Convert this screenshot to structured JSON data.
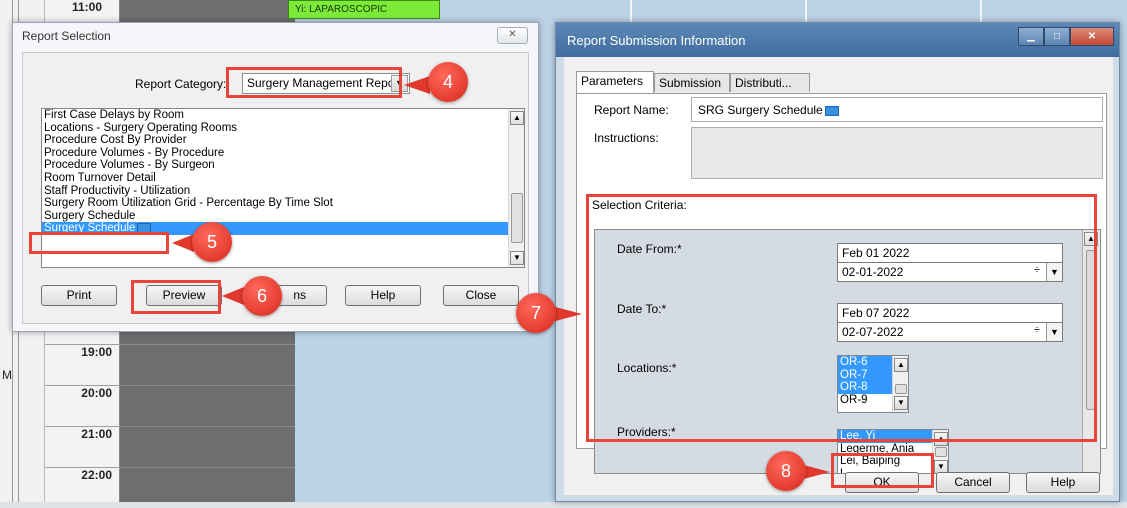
{
  "background": {
    "times": [
      "11:00",
      "19:00",
      "20:00",
      "21:00",
      "22:00"
    ],
    "case_label": "Yi: LAPAROSCOPIC",
    "edge_label": "M"
  },
  "report_selection": {
    "title": "Report Selection",
    "close_glyph": "✕",
    "category_label": "Report Category:",
    "category_value": "Surgery Management Repo",
    "reports": [
      "First Case Delays by Room",
      "Locations - Surgery Operating Rooms",
      "Procedure Cost By Provider",
      "Procedure Volumes - By Procedure",
      "Procedure Volumes - By Surgeon",
      "Room Turnover Detail",
      "Staff Productivity - Utilization",
      "Surgery Room Utilization Grid - Percentage By Time Slot",
      "Surgery Schedule",
      "Surgery Schedule"
    ],
    "selected_index": 9,
    "buttons": {
      "print": "Print",
      "preview": "Preview",
      "options": "ns",
      "help": "Help",
      "close": "Close"
    }
  },
  "submission": {
    "title": "Report Submission Information",
    "tabs": [
      "Parameters",
      "Submission",
      "Distributi..."
    ],
    "report_name_label": "Report Name:",
    "report_name_value": "SRG Surgery Schedule",
    "instructions_label": "Instructions:",
    "selection_criteria_label": "Selection Criteria:",
    "date_from_label": "Date From:*",
    "date_from_text": "Feb 01 2022",
    "date_from_value": "02-01-2022",
    "date_to_label": "Date To:*",
    "date_to_text": "Feb 07 2022",
    "date_to_value": "02-07-2022",
    "locations_label": "Locations:*",
    "locations": [
      "OR-6",
      "OR-7",
      "OR-8",
      "OR-9"
    ],
    "locations_selected": [
      0,
      1,
      2
    ],
    "providers_label": "Providers:*",
    "providers": [
      "Lee, Yi",
      "Legerme, Ania",
      "Lei, Baiping",
      "L..."
    ],
    "providers_selected": [
      0
    ],
    "buttons": {
      "ok": "OK",
      "cancel": "Cancel",
      "help": "Help"
    }
  },
  "callouts": {
    "c4": "4",
    "c5": "5",
    "c6": "6",
    "c7": "7",
    "c8": "8"
  },
  "colors": {
    "annotation_red": "#e8453a",
    "selection_blue": "#3399ff",
    "title_blue": "#4f7cab"
  }
}
